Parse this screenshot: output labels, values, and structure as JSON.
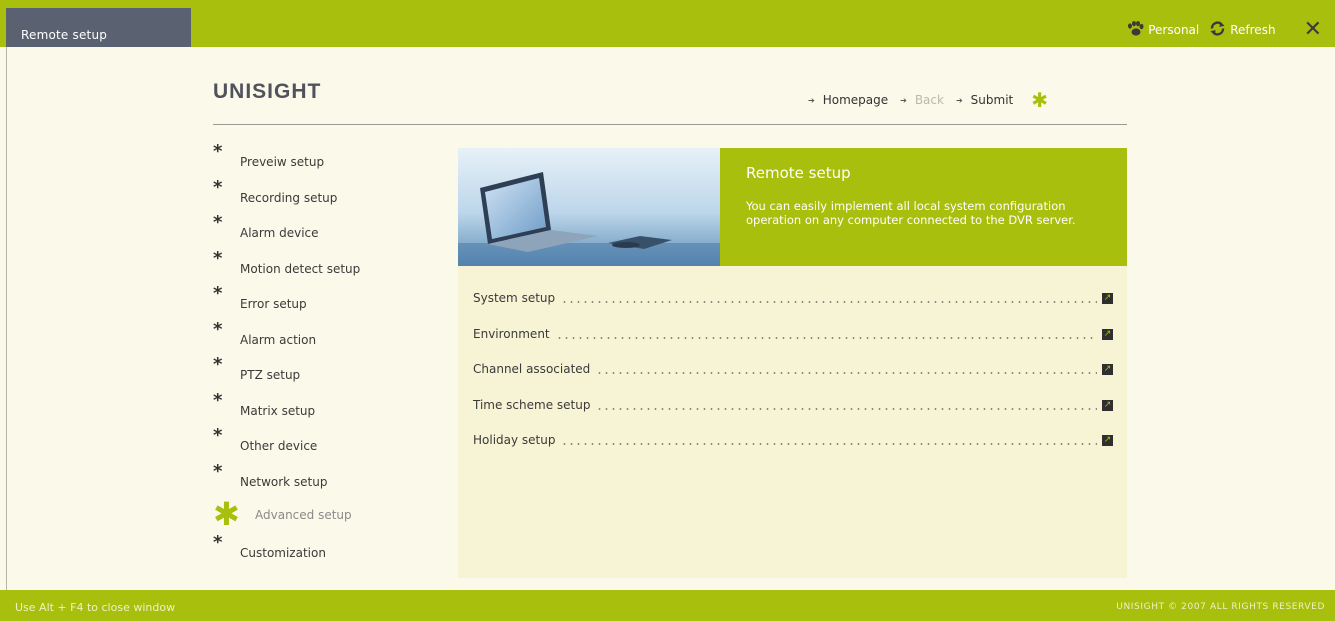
{
  "window": {
    "tab_title": "Remote setup",
    "personal_label": "Personal",
    "refresh_label": "Refresh",
    "close_glyph": "✕"
  },
  "header": {
    "logo_text": "UNISIGHT",
    "nav": {
      "homepage": "Homepage",
      "back": "Back",
      "submit": "Submit"
    }
  },
  "sidebar": {
    "items": [
      {
        "label": "Preveiw setup",
        "active": false
      },
      {
        "label": "Recording setup",
        "active": false
      },
      {
        "label": "Alarm device",
        "active": false
      },
      {
        "label": "Motion detect setup",
        "active": false
      },
      {
        "label": "Error setup",
        "active": false
      },
      {
        "label": "Alarm action",
        "active": false
      },
      {
        "label": "PTZ setup",
        "active": false
      },
      {
        "label": "Matrix setup",
        "active": false
      },
      {
        "label": "Other device",
        "active": false
      },
      {
        "label": "Network setup",
        "active": false
      },
      {
        "label": "Advanced setup",
        "active": true
      },
      {
        "label": "Customization",
        "active": false
      }
    ]
  },
  "hero": {
    "title": "Remote setup",
    "text": "You can easily implement all local system configuration operation on any computer connected to the DVR server."
  },
  "menu": {
    "items": [
      {
        "label": "System setup"
      },
      {
        "label": "Environment"
      },
      {
        "label": "Channel associated"
      },
      {
        "label": "Time scheme setup"
      },
      {
        "label": "Holiday setup"
      }
    ]
  },
  "footer": {
    "hint": "Use Alt + F4 to close window",
    "copyright": "UNISIGHT © 2007 ALL RIGHTS RESERVED"
  },
  "colors": {
    "accent": "#a8bf0e",
    "tab_bg": "#5a6171",
    "page_bg": "#fbf9ea"
  }
}
